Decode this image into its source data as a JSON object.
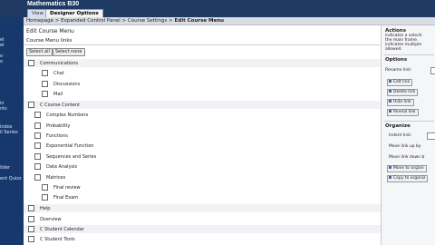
{
  "app": {
    "title": "Mathematics B30"
  },
  "tabs": {
    "view": "View",
    "designer": "Designer Options"
  },
  "left_nav": {
    "items": [
      "el",
      "el",
      "o",
      "o",
      "in",
      "nts",
      "indos",
      "il Series",
      "ilder",
      "ent Quizz"
    ]
  },
  "breadcrumb": {
    "home": "Homepage",
    "sep": ">",
    "expanded": "Expanded Control Panel",
    "settings": "Course Settings",
    "current": "Edit Course Menu"
  },
  "page": {
    "title": "Edit Course Menu",
    "subhead": "Course Menu links",
    "select_all": "Select all",
    "select_none": "Select none"
  },
  "menu_links": [
    {
      "label": "Communications"
    },
    {
      "label": "Chat"
    },
    {
      "label": "Discussions"
    },
    {
      "label": "Mail"
    },
    {
      "label": "C Course Content"
    },
    {
      "label": "Complex Numbers"
    },
    {
      "label": "Probability"
    },
    {
      "label": "Functions"
    },
    {
      "label": "Exponential Function"
    },
    {
      "label": "Sequences and Series"
    },
    {
      "label": "Data Analysis"
    },
    {
      "label": "Matrices"
    },
    {
      "label": "Final review"
    },
    {
      "label": "Final Exam"
    },
    {
      "label": "Help"
    },
    {
      "label": "Overview"
    },
    {
      "label": "C Student Calendar"
    },
    {
      "label": "C Student Tools"
    }
  ],
  "sidebar": {
    "actions_title": "Actions",
    "actions_line1": "indicates a selecti",
    "actions_line2": "the main frame.",
    "actions_line3": "indicates multiple",
    "actions_line4": "allowed.",
    "options_title": "Options",
    "rename_label": "Rename link:",
    "edit_link": "Edit link",
    "delete_link": "Delete link",
    "hide_link": "Hide link",
    "reveal_link": "Reveal link",
    "organize_title": "Organize",
    "indent_label": "Indent link:",
    "move_up": "Move link up by",
    "move_down": "Move link down b",
    "move_to": "Move to organi",
    "copy_to": "Copy to organiz"
  }
}
